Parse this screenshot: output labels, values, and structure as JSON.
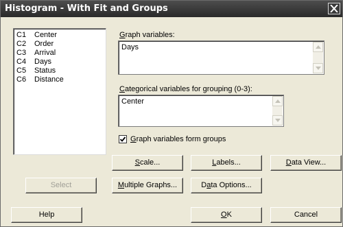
{
  "window": {
    "title": "Histogram - With Fit and Groups"
  },
  "variables": [
    {
      "col": "C1",
      "name": "Center"
    },
    {
      "col": "C2",
      "name": "Order"
    },
    {
      "col": "C3",
      "name": "Arrival"
    },
    {
      "col": "C4",
      "name": "Days"
    },
    {
      "col": "C5",
      "name": "Status"
    },
    {
      "col": "C6",
      "name": "Distance"
    }
  ],
  "graph_variables": {
    "label_pre": "",
    "label_key": "G",
    "label_post": "raph variables:",
    "value": "Days"
  },
  "categorical": {
    "label_pre": "",
    "label_key": "C",
    "label_post": "ategorical variables for grouping (0-3):",
    "value": "Center"
  },
  "form_groups": {
    "checked": true,
    "label_pre": "",
    "label_key": "G",
    "label_post": "raph variables form groups"
  },
  "buttons": {
    "scale": {
      "pre": "",
      "key": "S",
      "post": "cale..."
    },
    "labels": {
      "pre": "",
      "key": "L",
      "post": "abels..."
    },
    "data_view": {
      "pre": "",
      "key": "D",
      "post": "ata View..."
    },
    "select": "Select",
    "multiple_graphs": {
      "pre": "",
      "key": "M",
      "post": "ultiple Graphs..."
    },
    "data_options": {
      "pre": "D",
      "key": "a",
      "post": "ta Options..."
    },
    "help": "Help",
    "ok": {
      "pre": "",
      "key": "O",
      "post": "K"
    },
    "cancel": "Cancel"
  }
}
